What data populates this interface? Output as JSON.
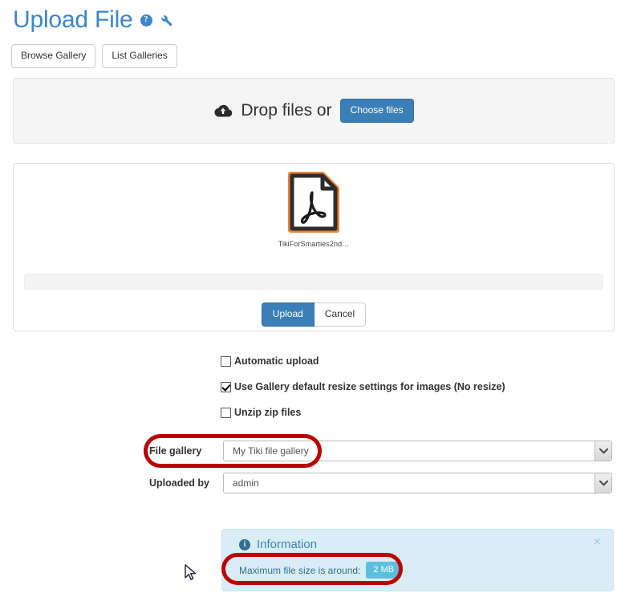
{
  "header": {
    "title": "Upload File",
    "help_icon": "help-circle-icon",
    "wrench_icon": "wrench-icon"
  },
  "toolbar": {
    "browse_gallery_label": "Browse Gallery",
    "list_galleries_label": "List Galleries"
  },
  "dropzone": {
    "icon": "cloud-upload-icon",
    "text": "Drop files or",
    "choose_files_label": "Choose files"
  },
  "preview": {
    "file_icon": "pdf-file-icon",
    "file_name": "TikiForSmarties2nd…",
    "progress_percent": 0,
    "upload_label": "Upload",
    "cancel_label": "Cancel"
  },
  "options": [
    {
      "label": "Automatic upload",
      "checked": false
    },
    {
      "label": "Use Gallery default resize settings for images (No resize)",
      "checked": true
    },
    {
      "label": "Unzip zip files",
      "checked": false
    }
  ],
  "form": {
    "file_gallery": {
      "label": "File gallery",
      "value": "My Tiki file gallery"
    },
    "uploaded_by": {
      "label": "Uploaded by",
      "value": "admin"
    }
  },
  "info_alert": {
    "icon": "info-circle-icon",
    "title": "Information",
    "close_label": "×",
    "body_text": "Maximum file size is around:",
    "size_badge": "2 MB"
  },
  "colors": {
    "title_blue": "#3a87c8",
    "primary_button": "#3a7fb8",
    "alert_background": "#d9edf7",
    "alert_text": "#31708f",
    "badge_blue": "#5bc0de",
    "annotation_red": "#bb0000",
    "dropzone_background": "#f5f5f5"
  }
}
